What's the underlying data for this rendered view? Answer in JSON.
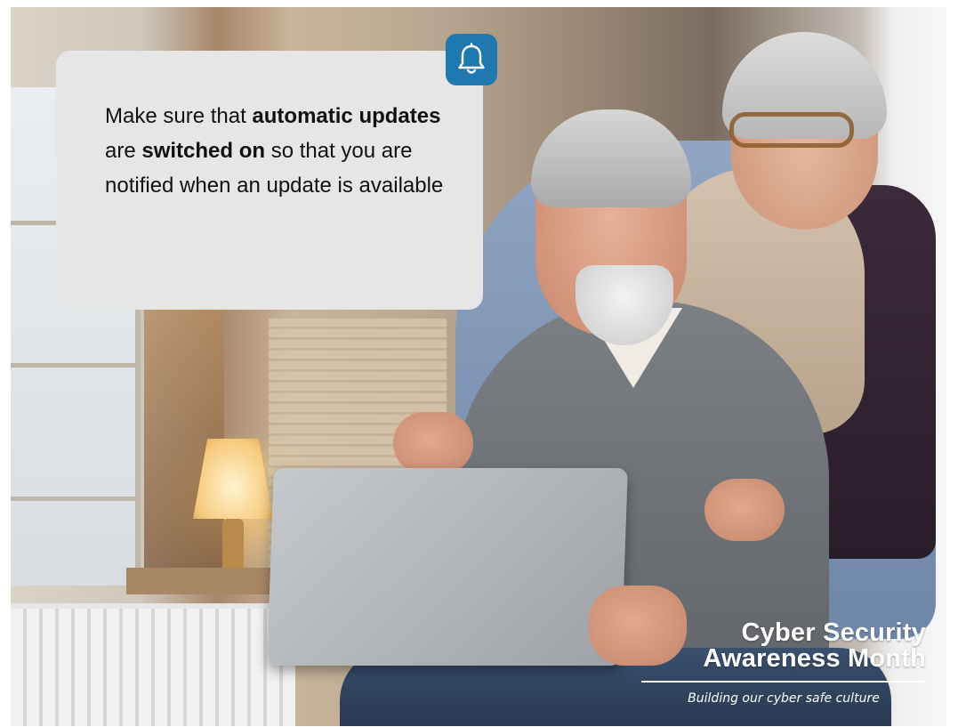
{
  "callout": {
    "segments": [
      {
        "text": "Make sure that ",
        "bold": false
      },
      {
        "text": "automatic updates",
        "bold": true
      },
      {
        "text": " are ",
        "bold": false
      },
      {
        "text": "switched on",
        "bold": true
      },
      {
        "text": " so that you are notified when an update is available",
        "bold": false
      }
    ],
    "icon": "bell-icon"
  },
  "brand": {
    "line1": "Cyber Security",
    "line2": "Awareness Month",
    "tagline": "Building our cyber safe culture"
  },
  "colors": {
    "bell_bg": "#1f78b0",
    "callout_bg": "#e6e6e6",
    "text": "#111111"
  }
}
